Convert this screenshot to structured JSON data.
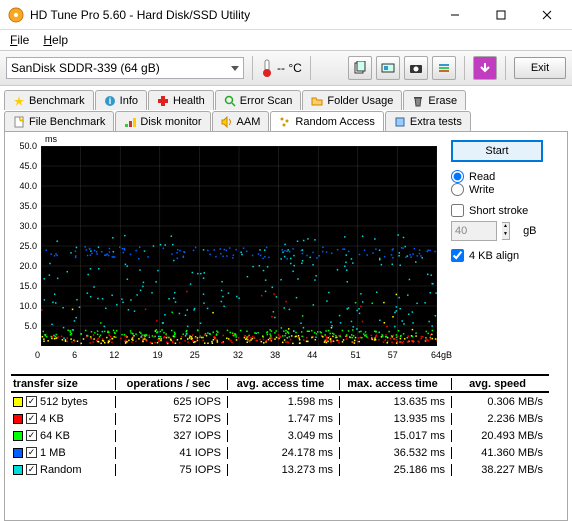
{
  "window": {
    "title": "HD Tune Pro 5.60 - Hard Disk/SSD Utility"
  },
  "menu": {
    "file": "File",
    "help": "Help"
  },
  "toolbar": {
    "drive": "SanDisk SDDR-339 (64 gB)",
    "temp_value": "-- °C",
    "exit": "Exit"
  },
  "tabs": {
    "benchmark": "Benchmark",
    "info": "Info",
    "health": "Health",
    "error_scan": "Error Scan",
    "folder_usage": "Folder Usage",
    "erase": "Erase",
    "file_benchmark": "File Benchmark",
    "disk_monitor": "Disk monitor",
    "aam": "AAM",
    "random_access": "Random Access",
    "extra_tests": "Extra tests"
  },
  "side": {
    "start": "Start",
    "read": "Read",
    "write": "Write",
    "short_stroke": "Short stroke",
    "stroke_val": "40",
    "stroke_unit": "gB",
    "align4kb": "4 KB align"
  },
  "chart_data": {
    "type": "scatter",
    "xlim": [
      0,
      64
    ],
    "ylim": [
      0,
      50
    ],
    "xlabel": "gB",
    "ylabel": "ms",
    "xticks": [
      0,
      6,
      12,
      19,
      25,
      32,
      38,
      44,
      51,
      57,
      "64gB"
    ],
    "yticks": [
      5.0,
      10.0,
      15.0,
      20.0,
      25.0,
      30.0,
      35.0,
      40.0,
      45.0,
      50.0
    ]
  },
  "table": {
    "headers": [
      "transfer size",
      "operations / sec",
      "avg. access time",
      "max. access time",
      "avg. speed"
    ],
    "rows": [
      {
        "color": "#ffff00",
        "size": "512 bytes",
        "ops": "625 IOPS",
        "avg": "1.598 ms",
        "max": "13.635 ms",
        "spd": "0.306 MB/s"
      },
      {
        "color": "#ff0000",
        "size": "4 KB",
        "ops": "572 IOPS",
        "avg": "1.747 ms",
        "max": "13.935 ms",
        "spd": "2.236 MB/s"
      },
      {
        "color": "#00ff00",
        "size": "64 KB",
        "ops": "327 IOPS",
        "avg": "3.049 ms",
        "max": "15.017 ms",
        "spd": "20.493 MB/s"
      },
      {
        "color": "#0060ff",
        "size": "1 MB",
        "ops": "41 IOPS",
        "avg": "24.178 ms",
        "max": "36.532 ms",
        "spd": "41.360 MB/s"
      },
      {
        "color": "#00dcdc",
        "size": "Random",
        "ops": "75 IOPS",
        "avg": "13.273 ms",
        "max": "25.186 ms",
        "spd": "38.227 MB/s"
      }
    ]
  }
}
